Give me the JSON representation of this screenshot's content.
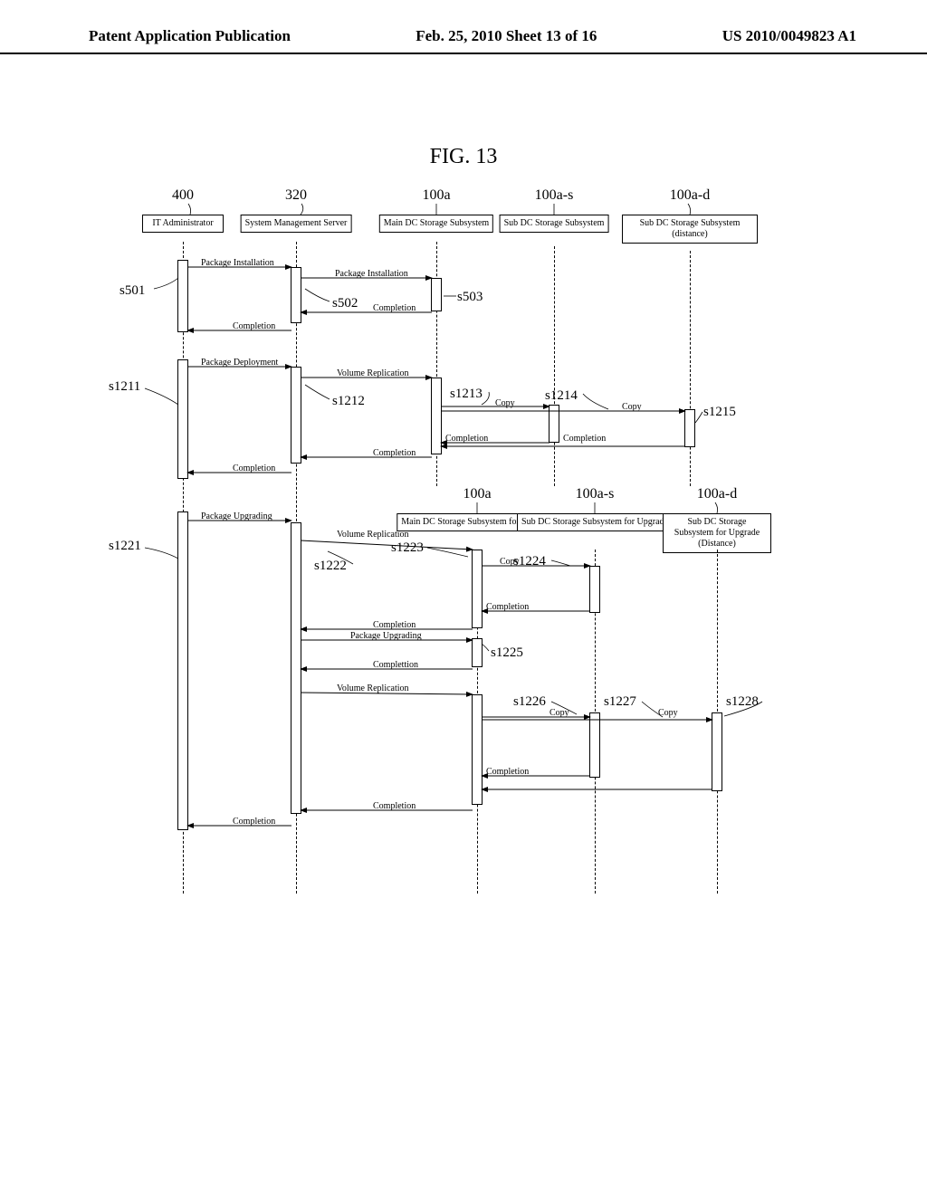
{
  "header": {
    "left": "Patent Application Publication",
    "center": "Feb. 25, 2010   Sheet 13 of 16",
    "right": "US 2010/0049823 A1"
  },
  "figure_title": "FIG. 13",
  "participants": {
    "p1": {
      "num": "400",
      "label": "IT Administrator"
    },
    "p2": {
      "num": "320",
      "label": "System Management\nServer"
    },
    "p3": {
      "num": "100a",
      "label": "Main DC Storage\nSubsystem"
    },
    "p4": {
      "num": "100a-s",
      "label": "Sub DC Storage\nSubsystem"
    },
    "p5": {
      "num": "100a-d",
      "label": "Sub DC Storage\nSubsystem\n(distance)"
    },
    "p3b": {
      "num": "100a",
      "label": "Main DC Storage\nSubsystem for Upgrade"
    },
    "p4b": {
      "num": "100a-s",
      "label": "Sub DC Storage\nSubsystem for Upgrade"
    },
    "p5b": {
      "num": "100a-d",
      "label": "Sub DC Storage\nSubsystem for Upgrade\n(Distance)"
    }
  },
  "messages": {
    "pkg_install1": "Package Installation",
    "pkg_install2": "Package Installation",
    "completion": "Completion",
    "pkg_deploy": "Package Deployment",
    "vol_repl": "Volume Replication",
    "copy": "Copy",
    "pkg_upgrade": "Package Upgrading",
    "completion2": "Complettion"
  },
  "step_labels": {
    "s501": "s501",
    "s502": "s502",
    "s503": "s503",
    "s1211": "s1211",
    "s1212": "s1212",
    "s1213": "s1213",
    "s1214": "s1214",
    "s1215": "s1215",
    "s1221": "s1221",
    "s1222": "s1222",
    "s1223": "s1223",
    "s1224": "s1224",
    "s1225": "s1225",
    "s1226": "s1226",
    "s1227": "s1227",
    "s1228": "s1228"
  },
  "chart_data": {
    "type": "sequence_diagram",
    "participants": [
      {
        "id": "400",
        "name": "IT Administrator"
      },
      {
        "id": "320",
        "name": "System Management Server"
      },
      {
        "id": "100a",
        "name": "Main DC Storage Subsystem"
      },
      {
        "id": "100a-s",
        "name": "Sub DC Storage Subsystem"
      },
      {
        "id": "100a-d",
        "name": "Sub DC Storage Subsystem (distance)"
      },
      {
        "id": "100a_upg",
        "name": "Main DC Storage Subsystem for Upgrade"
      },
      {
        "id": "100a-s_upg",
        "name": "Sub DC Storage Subsystem for Upgrade"
      },
      {
        "id": "100a-d_upg",
        "name": "Sub DC Storage Subsystem for Upgrade (Distance)"
      }
    ],
    "interactions": [
      {
        "step": "s501",
        "from": "400",
        "to": "320",
        "msg": "Package Installation"
      },
      {
        "step": "s502",
        "from": "320",
        "to": "100a",
        "msg": "Package Installation"
      },
      {
        "step": "s503",
        "from": "100a",
        "to": "100a",
        "msg": "(activation)"
      },
      {
        "from": "100a",
        "to": "320",
        "msg": "Completion"
      },
      {
        "from": "320",
        "to": "400",
        "msg": "Completion"
      },
      {
        "step": "s1211",
        "from": "400",
        "to": "320",
        "msg": "Package Deployment"
      },
      {
        "step": "s1212",
        "from": "320",
        "to": "100a",
        "msg": "Volume Replication"
      },
      {
        "step": "s1213",
        "from": "100a",
        "to": "100a-s",
        "msg": "Copy"
      },
      {
        "step": "s1214",
        "from": "100a",
        "to": "100a-d",
        "msg": "Copy"
      },
      {
        "step": "s1215",
        "from": "100a-d",
        "to": "100a-d",
        "msg": "(activation)"
      },
      {
        "from": "100a-s",
        "to": "100a",
        "msg": "Completion"
      },
      {
        "from": "100a-d",
        "to": "100a",
        "msg": "Completion"
      },
      {
        "from": "100a",
        "to": "320",
        "msg": "Completion"
      },
      {
        "from": "320",
        "to": "400",
        "msg": "Completion"
      },
      {
        "step": "s1221",
        "from": "400",
        "to": "320",
        "msg": "Package Upgrading"
      },
      {
        "step": "s1222",
        "from": "320",
        "to": "100a_upg",
        "msg": "Volume Replication"
      },
      {
        "step": "s1223",
        "from": "100a_upg",
        "to": "100a_upg",
        "msg": "(activation)"
      },
      {
        "step": "s1224",
        "from": "100a_upg",
        "to": "100a-s_upg",
        "msg": "Copy"
      },
      {
        "from": "100a-s_upg",
        "to": "100a_upg",
        "msg": "Completion"
      },
      {
        "from": "100a_upg",
        "to": "320",
        "msg": "Completion"
      },
      {
        "step": "s1225",
        "from": "320",
        "to": "100a_upg",
        "msg": "Package Upgrading"
      },
      {
        "from": "100a_upg",
        "to": "320",
        "msg": "Complettion"
      },
      {
        "step": "s1226",
        "from": "320",
        "to": "100a_upg",
        "msg": "Volume Replication"
      },
      {
        "step": "s1227",
        "from": "100a_upg",
        "to": "100a-s_upg",
        "msg": "Copy"
      },
      {
        "step": "s1228",
        "from": "100a_upg",
        "to": "100a-d_upg",
        "msg": "Copy"
      },
      {
        "from": "100a-s_upg",
        "to": "100a_upg",
        "msg": "Completion"
      },
      {
        "from": "100a-d_upg",
        "to": "100a_upg",
        "msg": "Completion"
      },
      {
        "from": "100a_upg",
        "to": "320",
        "msg": "Completion"
      },
      {
        "from": "320",
        "to": "400",
        "msg": "Completion"
      }
    ]
  }
}
